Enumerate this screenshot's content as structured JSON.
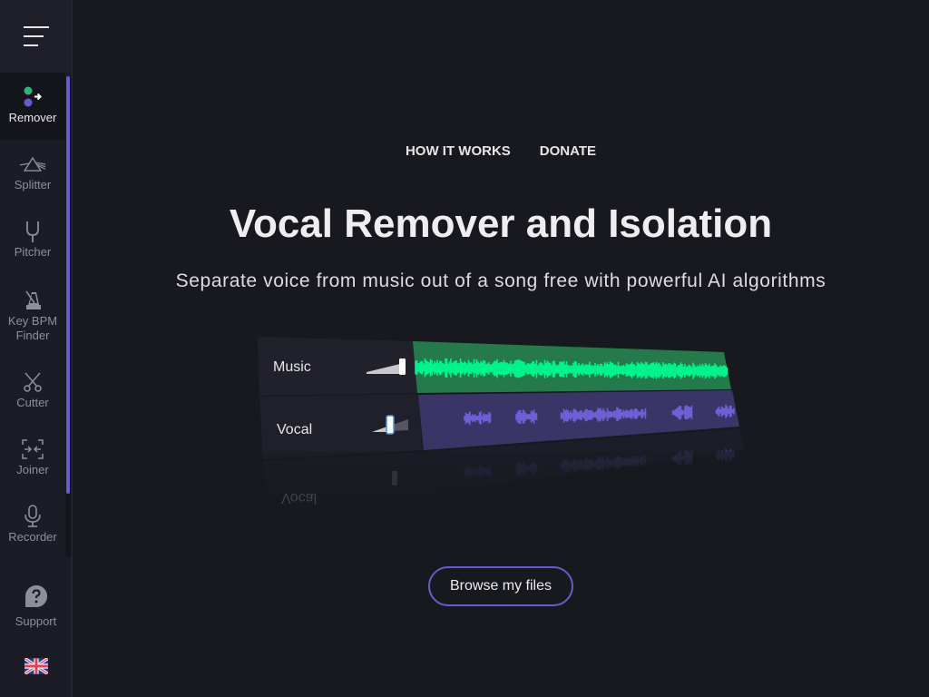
{
  "sidebar": {
    "menu_icon": "hamburger-menu-icon",
    "items": [
      {
        "label": "Remover",
        "icon": "remover-dots-arrow-icon",
        "active": true
      },
      {
        "label": "Splitter",
        "icon": "prism-icon",
        "active": false
      },
      {
        "label": "Pitcher",
        "icon": "tuning-fork-icon",
        "active": false
      },
      {
        "label": "Key BPM Finder",
        "icon": "metronome-icon",
        "active": false
      },
      {
        "label": "Cutter",
        "icon": "scissors-icon",
        "active": false
      },
      {
        "label": "Joiner",
        "icon": "joiner-arrows-icon",
        "active": false
      },
      {
        "label": "Recorder",
        "icon": "microphone-icon",
        "active": false
      }
    ],
    "support": {
      "label": "Support",
      "icon": "question-bubble-icon"
    },
    "language": {
      "icon": "uk-flag-icon"
    }
  },
  "header": {
    "links": [
      "HOW IT WORKS",
      "DONATE"
    ]
  },
  "hero": {
    "title": "Vocal Remover and Isolation",
    "subtitle": "Separate voice from music out of a song free with powerful AI algorithms"
  },
  "demo": {
    "tracks": [
      {
        "label": "Music",
        "volume": 1.0,
        "color": "#00f28a",
        "bg": "#257a4c"
      },
      {
        "label": "Vocal",
        "volume": 0.5,
        "color": "#6e5fd4",
        "bg": "#3a3566"
      }
    ],
    "reflection_label": "Vocal"
  },
  "cta": {
    "label": "Browse my files"
  },
  "colors": {
    "accent": "#6a5acd",
    "background": "#18191f",
    "sidebar": "#1c1c26"
  }
}
